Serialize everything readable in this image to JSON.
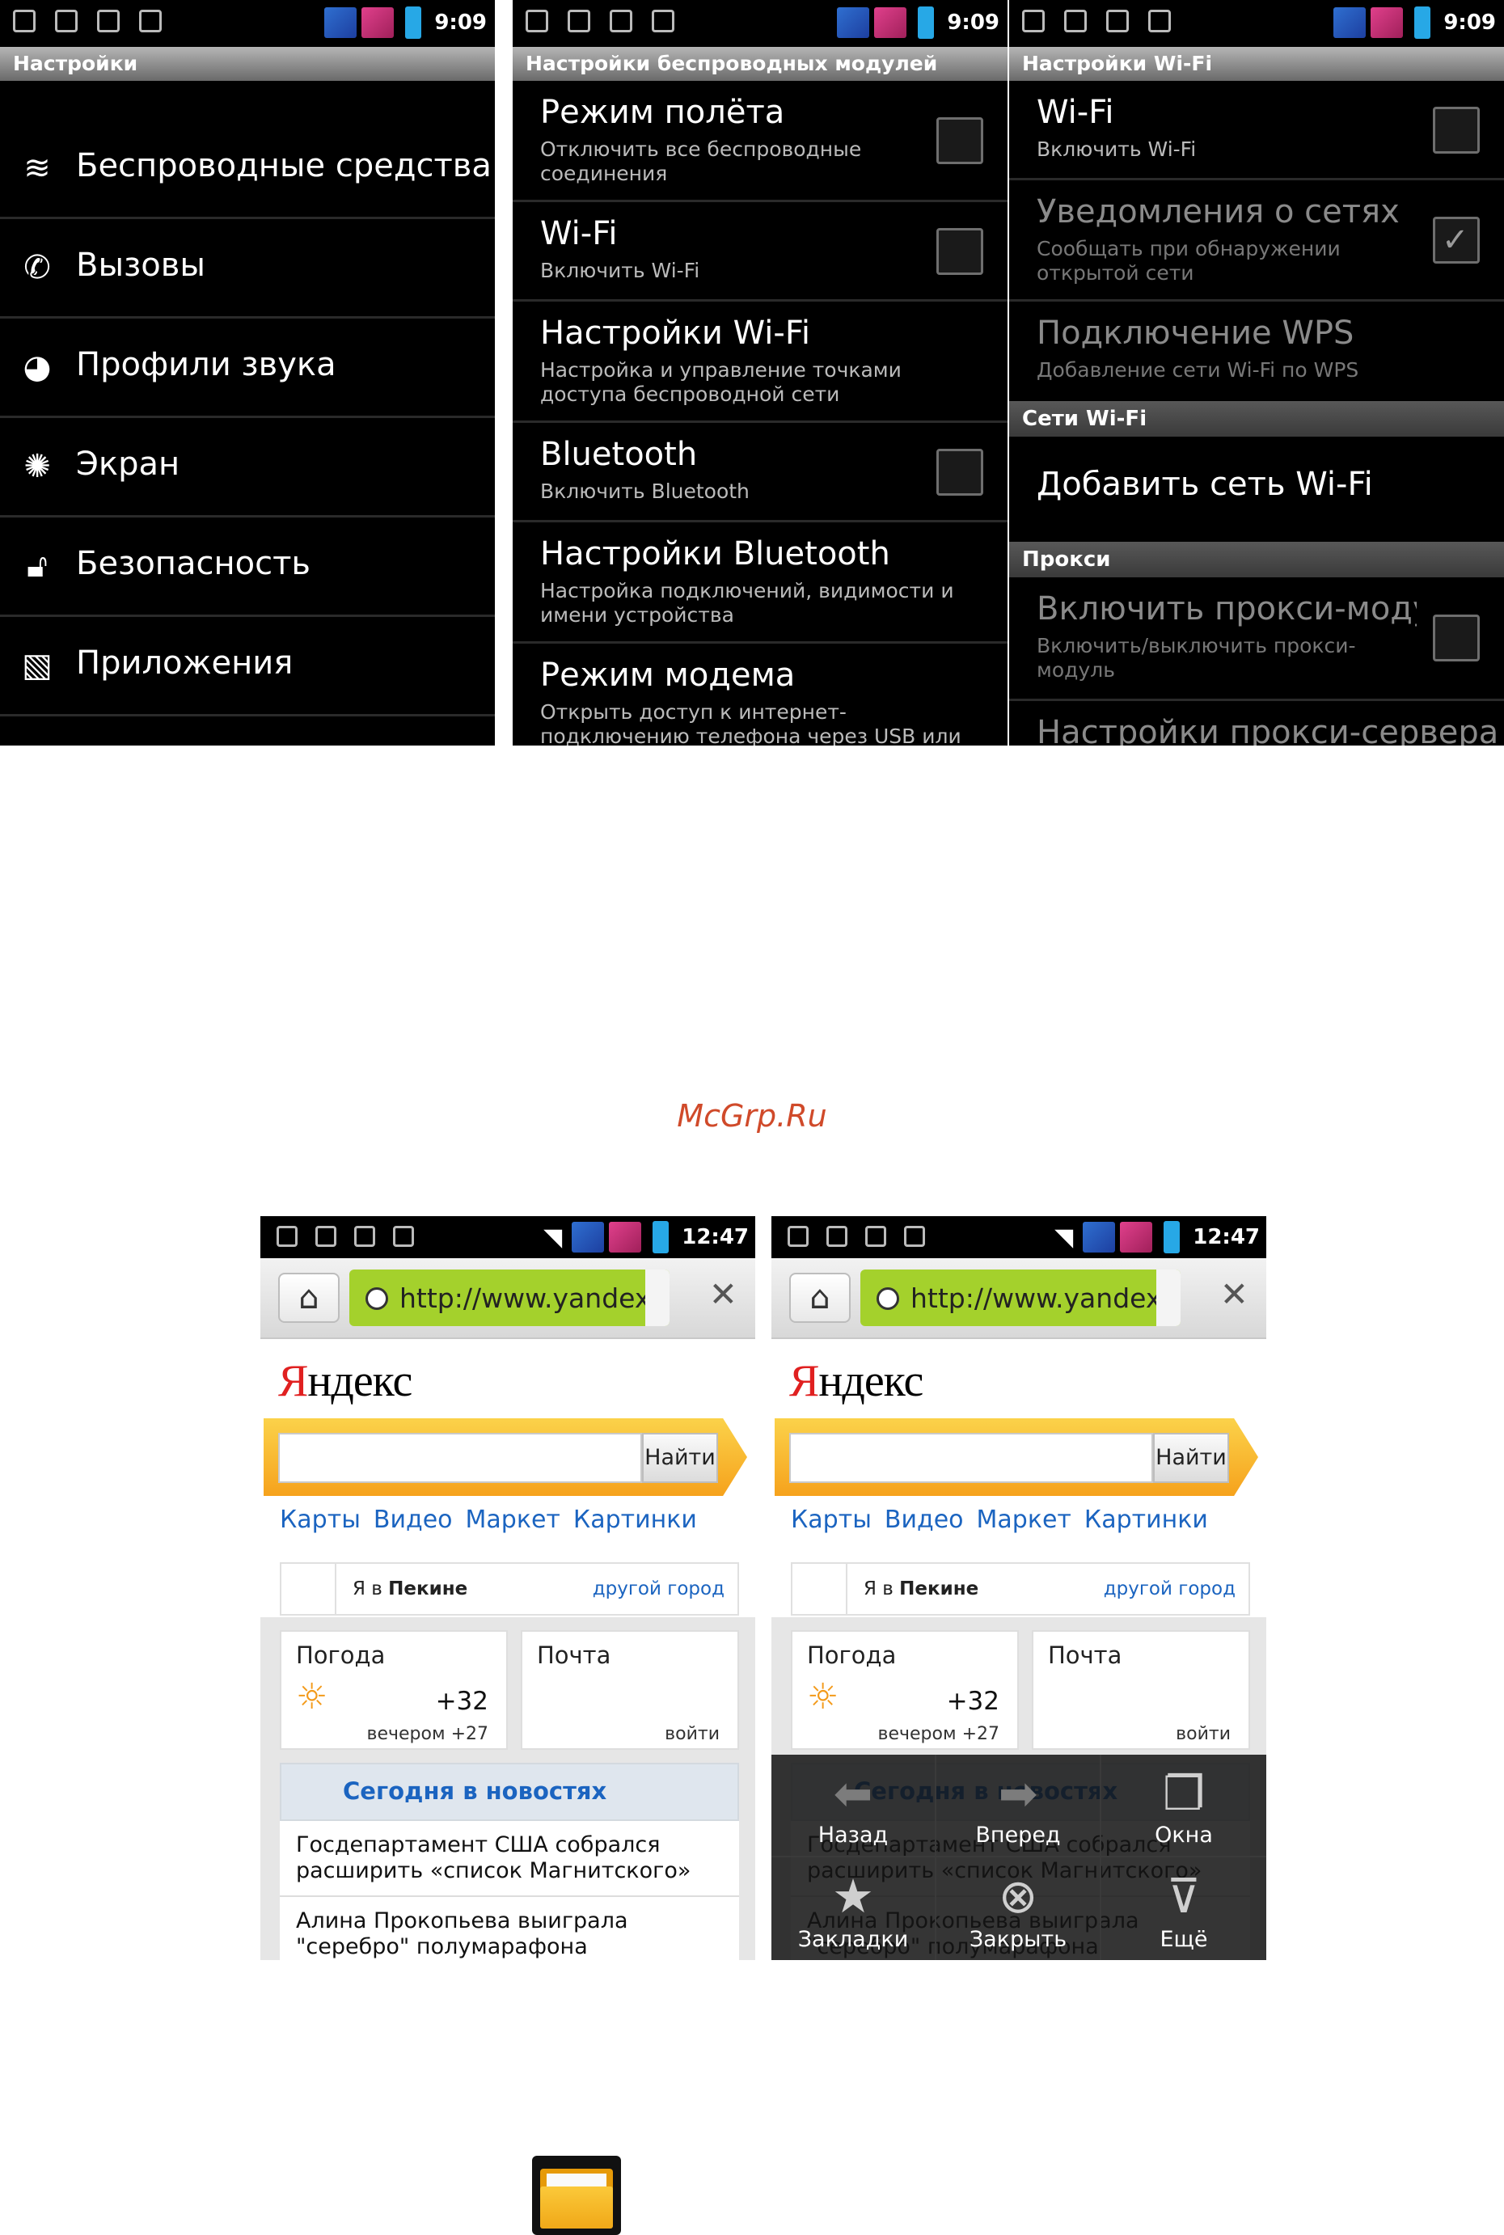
{
  "status_time_settings": "9:09",
  "status_time_browser": "12:47",
  "screen1": {
    "title": "Настройки",
    "items": [
      {
        "label": "Беспроводные средства",
        "icon": "wifi-icon"
      },
      {
        "label": "Вызовы",
        "icon": "phone-icon"
      },
      {
        "label": "Профили звука",
        "icon": "sound-profile-icon"
      },
      {
        "label": "Экран",
        "icon": "brightness-icon"
      },
      {
        "label": "Безопасность",
        "icon": "lock-icon"
      },
      {
        "label": "Приложения",
        "icon": "applications-icon"
      }
    ]
  },
  "screen2": {
    "title": "Настройки беспроводных модулей",
    "prefs": [
      {
        "title": "Режим полёта",
        "summary": "Отключить все беспроводные соединения",
        "checkbox": true,
        "checked": false
      },
      {
        "title": "Wi-Fi",
        "summary": "Включить Wi-Fi",
        "checkbox": true,
        "checked": false
      },
      {
        "title": "Настройки Wi-Fi",
        "summary": "Настройка и управление точками доступа беспроводной сети",
        "checkbox": false
      },
      {
        "title": "Bluetooth",
        "summary": "Включить Bluetooth",
        "checkbox": true,
        "checked": false
      },
      {
        "title": "Настройки Bluetooth",
        "summary": "Настройка подключений, видимости и имени устройства",
        "checkbox": false
      },
      {
        "title": "Режим модема",
        "summary": "Открыть доступ к интернет-подключению телефона через USB или Wi-Fi",
        "checkbox": false
      }
    ]
  },
  "screen3": {
    "title": "Настройки Wi-Fi",
    "wifi": {
      "title": "Wi-Fi",
      "summary": "Включить Wi-Fi"
    },
    "notify": {
      "title": "Уведомления о сетях",
      "summary": "Сообщать при обнаружении открытой сети"
    },
    "wps": {
      "title": "Подключение WPS",
      "summary": "Добавление сети Wi-Fi по WPS"
    },
    "cat_networks": "Сети Wi-Fi",
    "add_network": "Добавить сеть Wi-Fi",
    "cat_proxy": "Прокси",
    "proxy": {
      "title": "Включить прокси-модуль",
      "summary": "Включить/выключить прокси-модуль"
    },
    "proxy_settings": "Настройки прокси-сервера"
  },
  "watermark": "McGrp.Ru",
  "browser": {
    "url": "http://www.yandex...",
    "logo_first": "Я",
    "logo_rest": "ндекс",
    "search_button": "Найти",
    "links": [
      "Карты",
      "Видео",
      "Маркет",
      "Картинки"
    ],
    "city_prefix": "Я в ",
    "city_name": "Пекине",
    "other_city": "другой город",
    "weather_title": "Погода",
    "weather_temp": "+32",
    "weather_evening": "вечером +27",
    "mail_title": "Почта",
    "mail_login": "войти",
    "news_header": "Сегодня в новостях",
    "news": [
      "Госдепартамент США собрался расширить «список Магнитского»",
      "Алина Прокопьева выиграла \"серебро\" полумарафона"
    ],
    "menu": [
      {
        "label": "Назад",
        "icon": "back-arrow-icon"
      },
      {
        "label": "Вперед",
        "icon": "forward-arrow-icon"
      },
      {
        "label": "Окна",
        "icon": "windows-icon"
      },
      {
        "label": "Закладки",
        "icon": "bookmark-icon"
      },
      {
        "label": "Закрыть",
        "icon": "close-circle-icon"
      },
      {
        "label": "Ещё",
        "icon": "more-icon"
      }
    ]
  }
}
